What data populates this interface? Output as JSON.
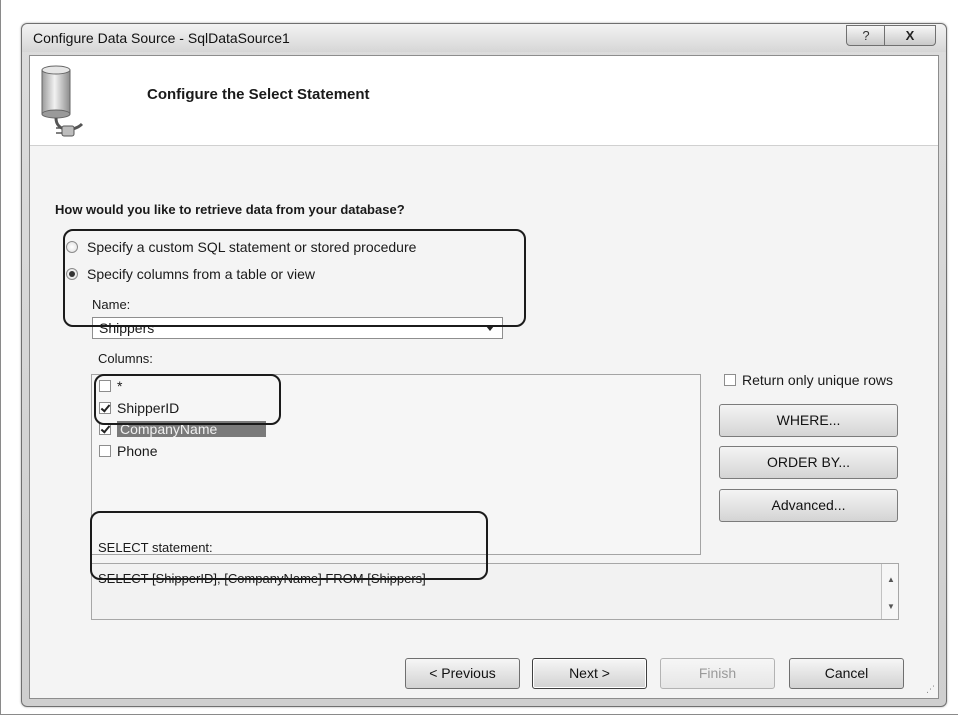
{
  "window": {
    "title": "Configure Data Source - SqlDataSource1",
    "help_glyph": "?",
    "close_glyph": "X"
  },
  "header": {
    "title": "Configure the Select Statement",
    "icon": "database-plug-icon"
  },
  "question": "How would you like to retrieve data from your database?",
  "options": {
    "custom_sql": {
      "label": "Specify a custom SQL statement or stored procedure",
      "checked": false
    },
    "columns": {
      "label": "Specify columns from a table or view",
      "checked": true
    }
  },
  "name_field": {
    "label": "Name:",
    "value": "Shippers"
  },
  "columns": {
    "label": "Columns:",
    "items": [
      {
        "name": "*",
        "checked": false
      },
      {
        "name": "ShipperID",
        "checked": true
      },
      {
        "name": "CompanyName",
        "checked": true
      },
      {
        "name": "Phone",
        "checked": false
      }
    ]
  },
  "unique_rows": {
    "label": "Return only unique rows",
    "checked": false
  },
  "buttons": {
    "where": "WHERE...",
    "order_by": "ORDER BY...",
    "advanced": "Advanced..."
  },
  "select_statement": {
    "label": "SELECT statement:",
    "value": "SELECT [ShipperID], [CompanyName] FROM [Shippers]"
  },
  "footer": {
    "previous": "< Previous",
    "next": "Next >",
    "finish": "Finish",
    "cancel": "Cancel"
  },
  "colors": {
    "selection": "#7a7a7a",
    "callout": "#1b1b1b"
  }
}
